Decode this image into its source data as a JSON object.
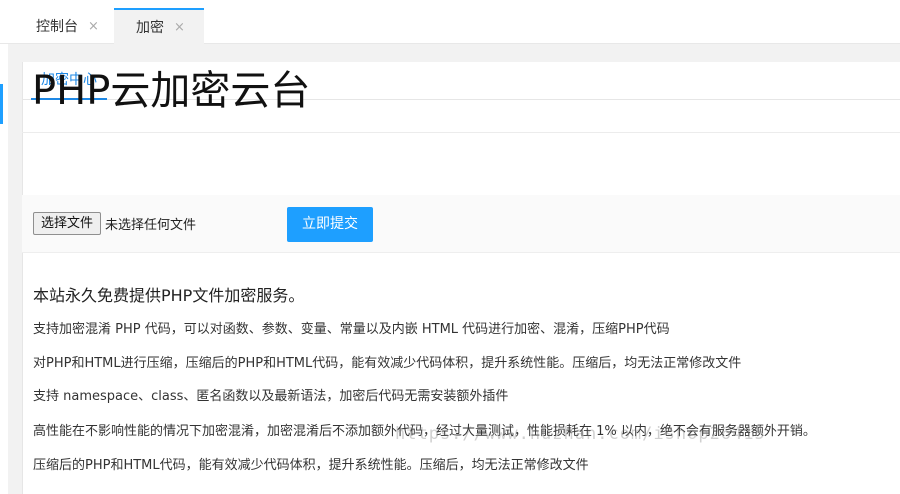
{
  "tabs": [
    {
      "label": "控制台",
      "close": "×"
    },
    {
      "label": "加密",
      "close": "×"
    }
  ],
  "subtab": {
    "label": "加密中心"
  },
  "page": {
    "title": "PHP云加密云台"
  },
  "form": {
    "file_button": "选择文件",
    "file_status": "未选择任何文件",
    "submit_label": "立即提交"
  },
  "info": {
    "heading": "本站永久免费提供PHP文件加密服务。",
    "lines": [
      "支持加密混淆 PHP 代码，可以对函数、参数、变量、常量以及内嵌 HTML 代码进行加密、混淆，压缩PHP代码",
      "对PHP和HTML进行压缩，压缩后的PHP和HTML代码，能有效减少代码体积，提升系统性能。压缩后，均无法正常修改文件",
      "支持 namespace、class、匿名函数以及最新语法，加密后代码无需安装额外插件",
      "高性能在不影响性能的情况下加密混淆，加密混淆后不添加额外代码，经过大量测试，性能损耗在 1% 以内，绝不会有服务器额外开销。",
      "压缩后的PHP和HTML代码，能有效减少代码体积，提升系统性能。压缩后，均无法正常修改文件"
    ]
  },
  "watermark": "https://www.huzhan.com/ishop26415",
  "colors": {
    "accent": "#1e9fff",
    "link": "#1e88e5"
  }
}
